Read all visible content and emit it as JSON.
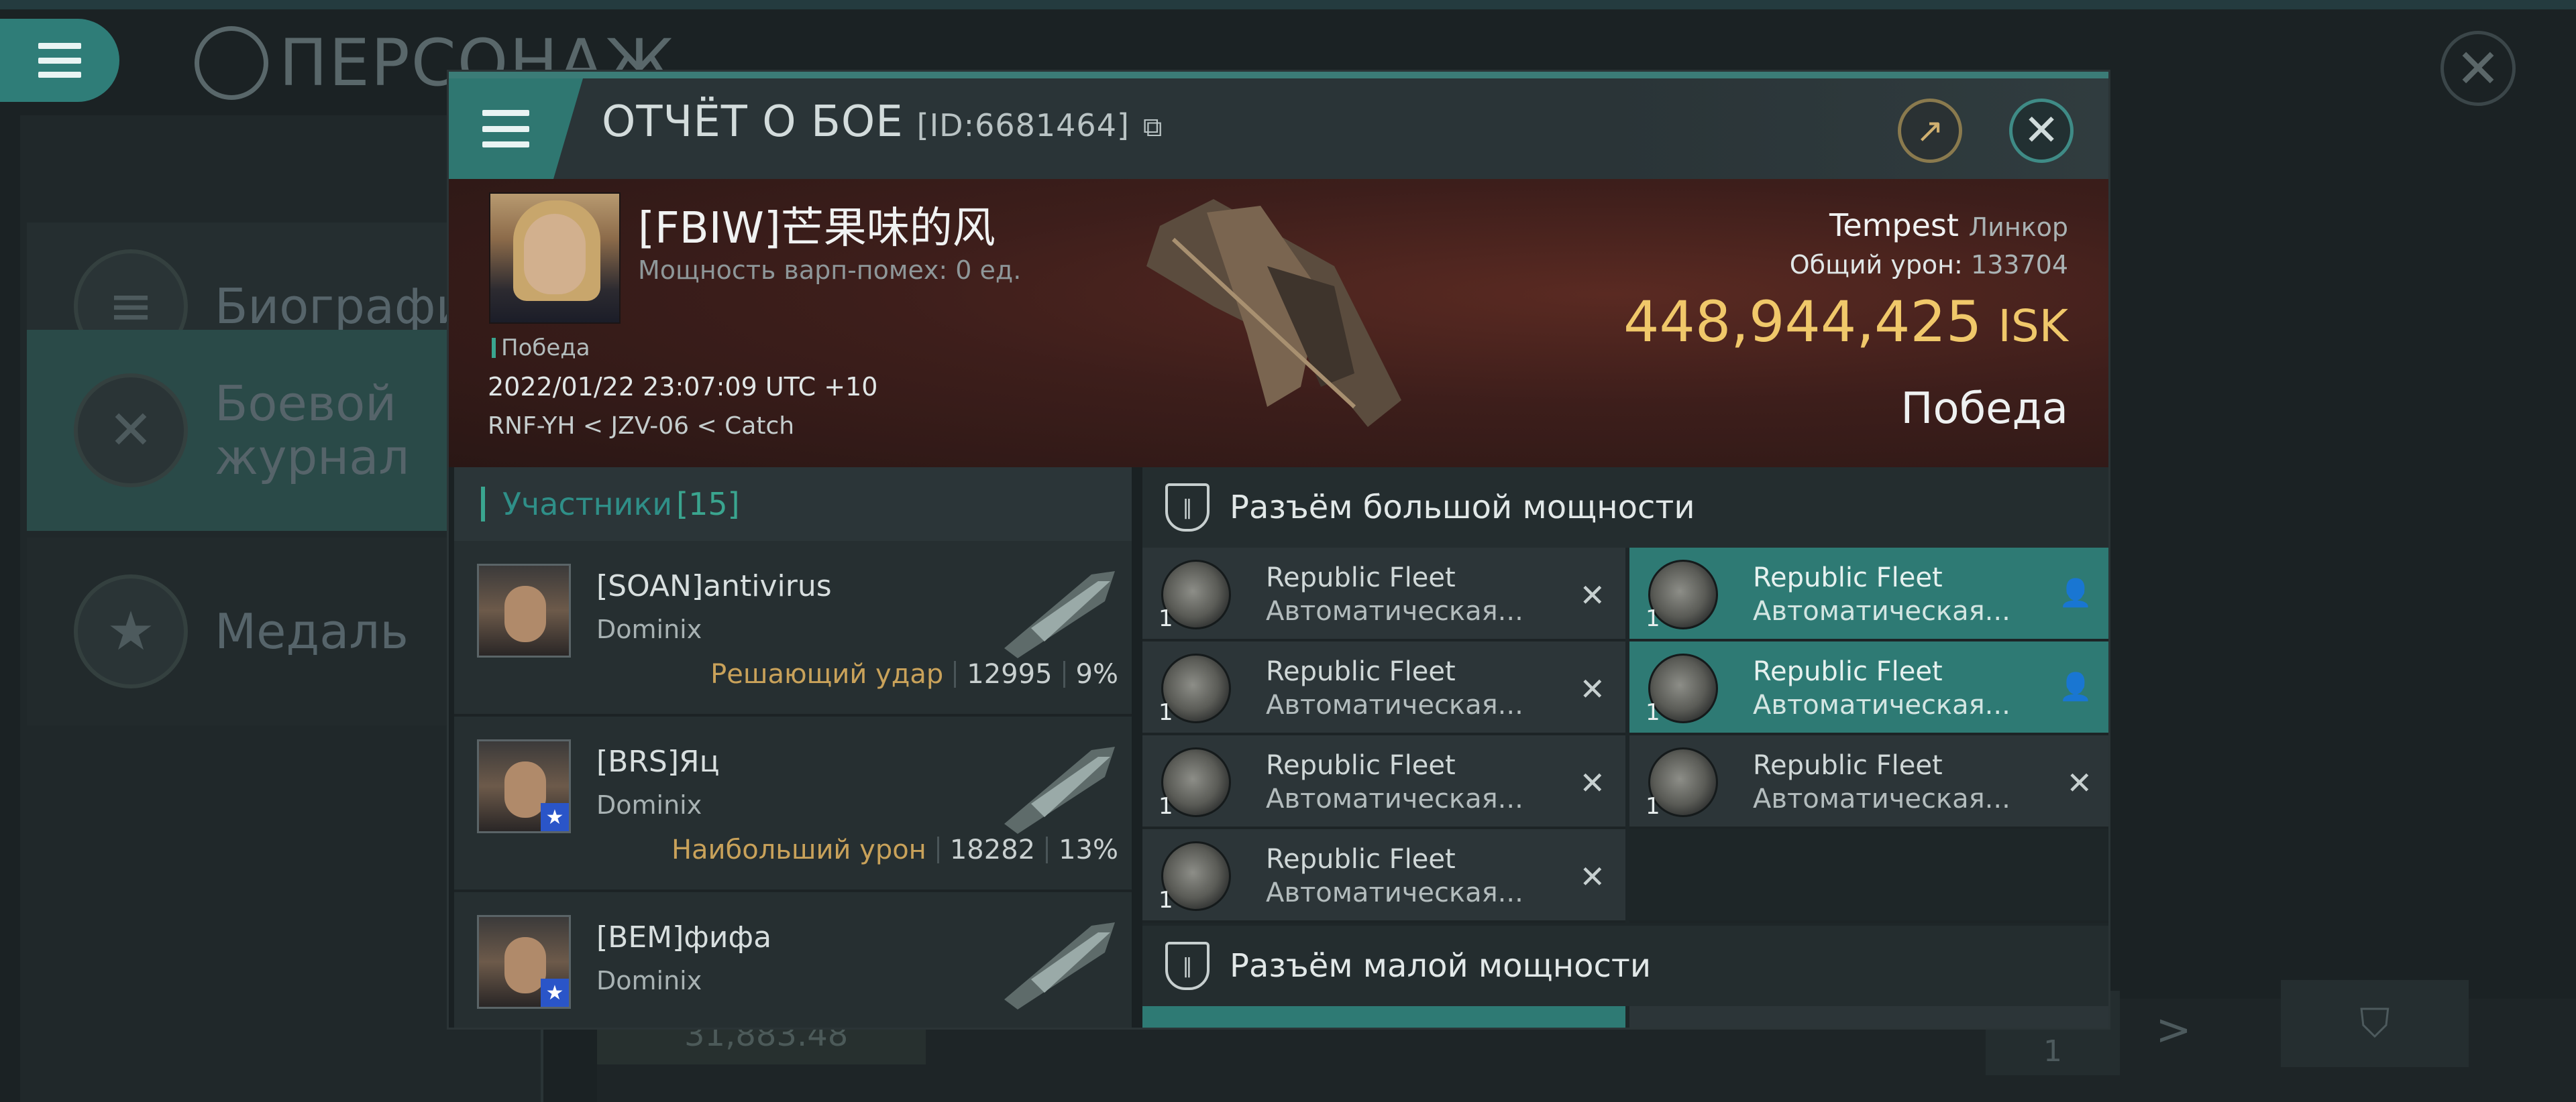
{
  "background": {
    "title": "ПЕРСОНАЖ",
    "sidebar": [
      {
        "label": "Биография",
        "icon": "menu-icon"
      },
      {
        "label": "Боевой журнал",
        "icon": "crossed-swords-icon"
      },
      {
        "label": "Медаль",
        "icon": "star-medal-icon"
      }
    ],
    "bottom_value": "31,883.48",
    "page_number": "1"
  },
  "modal": {
    "title": "ОТЧЁТ О БОЕ",
    "report_id": "[ID:6681464]",
    "victim": {
      "name": "[FBIW]芒果味的风",
      "warp_disruption": "Мощность варп-помех: 0 ед.",
      "status_small": "Победа",
      "datetime": "2022/01/22 23:07:09 UTC +10",
      "location": "RNF-YH < JZV-06 < Catch",
      "ship": "Tempest",
      "ship_class": "Линкор",
      "damage_label": "Общий урон:",
      "damage_value": "133704",
      "isk_value": "448,944,425",
      "isk_unit": "ISK",
      "status_big": "Победа"
    },
    "participants": {
      "label": "Участники",
      "count": "[15]",
      "rows": [
        {
          "name": "[SOAN]antivirus",
          "ship": "Dominix",
          "role": "Решающий удар",
          "damage": "12995",
          "percent": "9%"
        },
        {
          "name": "[BRS]Яц",
          "ship": "Dominix",
          "role": "Наибольший урон",
          "damage": "18282",
          "percent": "13%"
        },
        {
          "name": "[BEM]фифа",
          "ship": "Dominix",
          "role": "",
          "damage": "",
          "percent": ""
        }
      ]
    },
    "modules": {
      "high_slot_label": "Разъём большой мощности",
      "low_slot_label": "Разъём малой мощности",
      "items": [
        {
          "name": "Republic Fleet",
          "sub": "Автоматическая...",
          "qty": "1",
          "state": "destroyed",
          "active": false
        },
        {
          "name": "Republic Fleet",
          "sub": "Автоматическая...",
          "qty": "1",
          "state": "dropped",
          "active": true
        },
        {
          "name": "Republic Fleet",
          "sub": "Автоматическая...",
          "qty": "1",
          "state": "destroyed",
          "active": false
        },
        {
          "name": "Republic Fleet",
          "sub": "Автоматическая...",
          "qty": "1",
          "state": "dropped",
          "active": true
        },
        {
          "name": "Republic Fleet",
          "sub": "Автоматическая...",
          "qty": "1",
          "state": "destroyed",
          "active": false
        },
        {
          "name": "Republic Fleet",
          "sub": "Автоматическая...",
          "qty": "1",
          "state": "destroyed",
          "active": false
        },
        {
          "name": "Republic Fleet",
          "sub": "Автоматическая...",
          "qty": "1",
          "state": "destroyed",
          "active": false
        }
      ]
    }
  },
  "colors": {
    "accent": "#2f7771",
    "isk": "#f0c86a",
    "role": "#c9a25a"
  }
}
